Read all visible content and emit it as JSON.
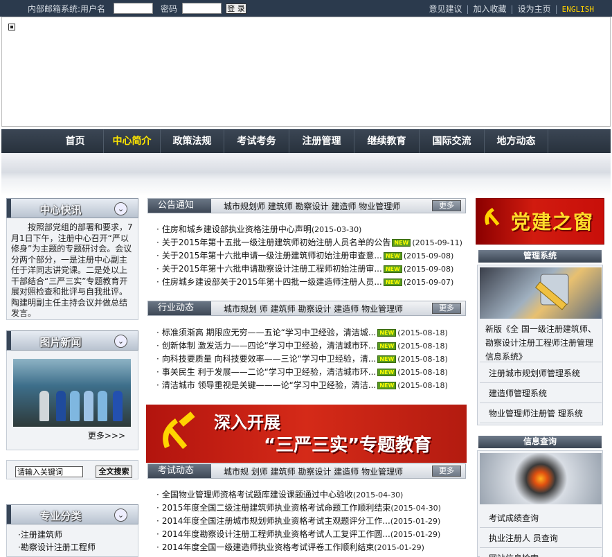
{
  "topbar": {
    "email_label": "内部邮箱系统:用户名",
    "password_label": "密码",
    "login_button": "登 录",
    "links": [
      "意见建议",
      "加入收藏",
      "设为主页"
    ],
    "english": "ENGLISH",
    "separator": "|"
  },
  "nav": {
    "items": [
      "首页",
      "中心简介",
      "政策法规",
      "考试考务",
      "注册管理",
      "继续教育",
      "国际交流",
      "地方动态"
    ],
    "active": "中心简介"
  },
  "news_flash": {
    "title": "中心快讯",
    "text": "按照部党组的部署和要求，7月1日下午，注册中心召开“严以修身”为主题的专题研讨会。会议分两个部分，一是注册中心副主任于洋同志讲党课。二是处以上干部结合“三严三实”专题教育开展对照检查和批评与自我批评。陶建明副主任主持会议并做总结发言。"
  },
  "photo_news": {
    "title": "图片新闻",
    "more": "更多>>>"
  },
  "search": {
    "value": "请输入关键词",
    "button": "全文搜索"
  },
  "categories": {
    "title": "专业分类",
    "items": [
      "注册建筑师",
      "勘察设计注册工程师"
    ]
  },
  "announcements": {
    "tab": "公告通知",
    "tabs": "城市规划师  建筑师  勘察设计  建造师  物业管理师",
    "more": "更多",
    "items": [
      {
        "title": "住房和城乡建设部执业资格注册中心声明",
        "new": false,
        "date": "(2015-03-30)"
      },
      {
        "title": "关于2015年第十五批一级注册建筑师初始注册人员名单的公告",
        "new": true,
        "date": "(2015-09-11)"
      },
      {
        "title": "关于2015年第十六批申请一级注册建筑师初始注册审查意...",
        "new": true,
        "date": "(2015-09-08)"
      },
      {
        "title": "关于2015年第十六批申请勘察设计注册工程师初始注册审...",
        "new": true,
        "date": "(2015-09-08)"
      },
      {
        "title": "住房城乡建设部关于2015年第十四批一级建造师注册人员...",
        "new": true,
        "date": "(2015-09-07)"
      }
    ]
  },
  "industry": {
    "tab": "行业动态",
    "tabs": "城市规划 师 建筑师 勘察设计 建造师 物业管理师",
    "more": "更多",
    "items": [
      {
        "title": "标准须渐高 期限应无穷——五论“学习中卫经验，清洁城...",
        "new": true,
        "date": "(2015-08-18)"
      },
      {
        "title": "创新体制 激发活力——四论“学习中卫经验，清洁城市环...",
        "new": true,
        "date": "(2015-08-18)"
      },
      {
        "title": "向科技要质量 向科技要效率——三论“学习中卫经验，清...",
        "new": true,
        "date": "(2015-08-18)"
      },
      {
        "title": "事关民生 利于发展——二论“学习中卫经验，清洁城市环...",
        "new": true,
        "date": "(2015-08-18)"
      },
      {
        "title": "清洁城市 领导重视是关键———论“学习中卫经验，清洁...",
        "new": true,
        "date": "(2015-08-18)"
      }
    ]
  },
  "promo": {
    "line1": "深入开展",
    "line2": "“三严三实”专题教育"
  },
  "exams": {
    "tab": "考试动态",
    "tabs": "城市规 划师 建筑师 勘察设计 建造师 物业管理师",
    "more": "更多",
    "items": [
      {
        "title": "全国物业管理师资格考试题库建设课题通过中心验收",
        "new": false,
        "date": "(2015-04-30)"
      },
      {
        "title": "2015年度全国二级注册建筑师执业资格考试命题工作顺利结束",
        "new": false,
        "date": "(2015-04-30)"
      },
      {
        "title": "2014年度全国注册城市规划师执业资格考试主观题评分工作...",
        "new": false,
        "date": "(2015-01-29)"
      },
      {
        "title": "2014年度勘察设计注册工程师执业资格考试人工复评工作圆...",
        "new": false,
        "date": "(2015-01-29)"
      },
      {
        "title": "2014年度全国一级建造师执业资格考试评卷工作顺利结束",
        "new": false,
        "date": "(2015-01-29)"
      }
    ]
  },
  "new_badge": "NEW",
  "party": {
    "title": "党建之窗"
  },
  "mgmt": {
    "title": "管理系统",
    "items": [
      "新版《全 国一级注册建筑师、勘察设计注册工程师注册管理信息系统》",
      "注册城市规划师管理系统",
      "建造师管理系统",
      "物业管理师注册管 理系统"
    ]
  },
  "info": {
    "title": "信息查询",
    "items": [
      "考试成绩查询",
      "执业注册人 员查询",
      "网站信息检索"
    ]
  },
  "colors": {
    "nav_bg": "#2b3a4d",
    "active": "#ffe600",
    "party_red": "#c80f0a"
  }
}
